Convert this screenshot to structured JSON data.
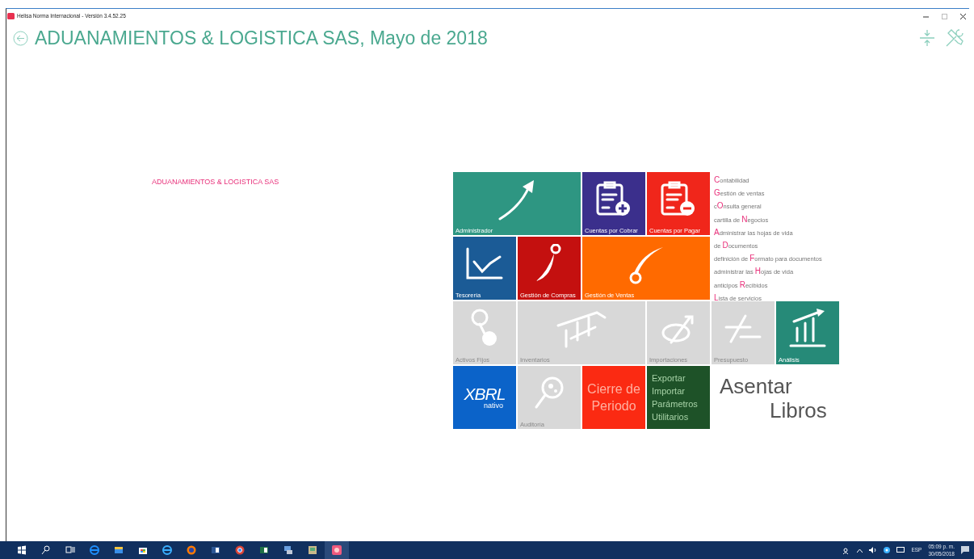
{
  "window": {
    "title": "Helisa Norma Internacional - Versión 3.4.52.25"
  },
  "heading": "ADUANAMIENTOS & LOGISTICA SAS, Mayo de 2018",
  "company": "ADUANAMIENTOS & LOGISTICA SAS",
  "tiles": [
    {
      "kind": "icon",
      "label": "Administrador",
      "color": "#2e9682",
      "disabled": false
    },
    {
      "kind": "icon",
      "label": "Cuentas por Cobrar",
      "color": "#3b2f8c",
      "disabled": false
    },
    {
      "kind": "icon",
      "label": "Cuentas por Pagar",
      "color": "#f0261b",
      "disabled": false
    },
    {
      "kind": "icon",
      "label": "Tesorería",
      "color": "#1b5b96",
      "disabled": false
    },
    {
      "kind": "icon",
      "label": "Gestión de Compras",
      "color": "#c4100f",
      "disabled": false
    },
    {
      "kind": "icon",
      "label": "Gestión de Ventas",
      "color": "#ff6a00",
      "disabled": false
    },
    {
      "kind": "icon",
      "label": "Activos Fijos",
      "disabled": true
    },
    {
      "kind": "icon",
      "label": "Inventarios",
      "disabled": true
    },
    {
      "kind": "icon",
      "label": "Importaciones",
      "disabled": true
    },
    {
      "kind": "icon",
      "label": "Presupuesto",
      "disabled": true
    },
    {
      "kind": "icon",
      "label": "Análisis",
      "color": "#268a78",
      "disabled": false
    },
    {
      "kind": "logo",
      "logo": "XBRL",
      "sub": "nativo",
      "color": "#0b63c9",
      "disabled": false
    },
    {
      "kind": "icon",
      "label": "Auditoría",
      "disabled": true
    },
    {
      "kind": "caption",
      "label": "Cierre de Periodo",
      "color": "#fb2a12",
      "disabled": false
    },
    {
      "kind": "list",
      "lines": [
        "Exportar",
        "Importar",
        "Parámetros",
        "Utilitarios"
      ],
      "color": "#1e5228",
      "disabled": false
    },
    {
      "kind": "plain",
      "label": "Asentar Libros",
      "disabled": false
    }
  ],
  "shortcuts": [
    {
      "key": "C",
      "after": "ontabilidad"
    },
    {
      "key": "G",
      "after": "estión de ventas"
    },
    {
      "before": "c",
      "key": "O",
      "after": "nsulta general"
    },
    {
      "before": "cartilla de ",
      "key": "N",
      "after": "egocios"
    },
    {
      "key": "A",
      "after": "dministrar las hojas de vida"
    },
    {
      "before": "de ",
      "key": "D",
      "after": "ocumentos"
    },
    {
      "before": "definición de ",
      "key": "F",
      "after": "ormato para documentos"
    },
    {
      "before": "administrar las ",
      "key": "H",
      "after": "ojas de vida"
    },
    {
      "before": "anticipos ",
      "key": "R",
      "after": "ecibidos"
    },
    {
      "key": "L",
      "after": "ista de servicios"
    }
  ],
  "tray": {
    "language": "ESP",
    "time": "05:09 p. m.",
    "date": "30/05/2018"
  }
}
